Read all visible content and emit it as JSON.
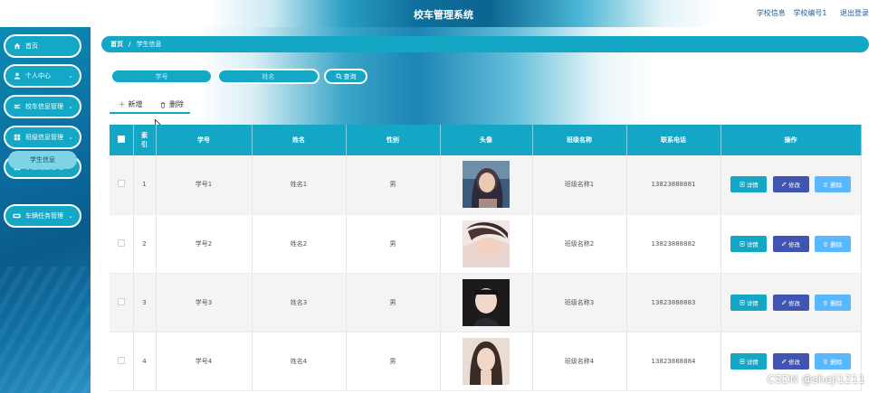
{
  "header": {
    "title": "校车管理系统",
    "school_info": "学校信息",
    "school_id": "学校编号1",
    "logout": "退出登录"
  },
  "sidebar": {
    "items": [
      {
        "label": "首页",
        "icon": "home-icon"
      },
      {
        "label": "个人中心",
        "icon": "user-icon"
      },
      {
        "label": "校车信息管理",
        "icon": "bus-icon"
      },
      {
        "label": "班级信息管理",
        "icon": "grid-icon"
      },
      {
        "label": "学生信息管理",
        "icon": "grid-icon"
      },
      {
        "label": "车辆任务管理",
        "icon": "vehicle-icon"
      }
    ],
    "sub_item": "学生信息"
  },
  "breadcrumb": {
    "home": "首页",
    "separator": "/",
    "current": "学生信息"
  },
  "search": {
    "student_id_placeholder": "学号",
    "name_placeholder": "姓名",
    "query_button": "查询"
  },
  "actions": {
    "add": "新增",
    "delete": "删除"
  },
  "table": {
    "headers": [
      "索引",
      "学号",
      "姓名",
      "性别",
      "头像",
      "班级名称",
      "联系电话",
      "操作"
    ],
    "rows": [
      {
        "index": "1",
        "student_id": "学号1",
        "name": "姓名1",
        "gender": "男",
        "class_name": "班级名称1",
        "phone": "13823888881"
      },
      {
        "index": "2",
        "student_id": "学号2",
        "name": "姓名2",
        "gender": "男",
        "class_name": "班级名称2",
        "phone": "13823888882"
      },
      {
        "index": "3",
        "student_id": "学号3",
        "name": "姓名3",
        "gender": "男",
        "class_name": "班级名称3",
        "phone": "13823888883"
      },
      {
        "index": "4",
        "student_id": "学号4",
        "name": "姓名4",
        "gender": "男",
        "class_name": "班级名称4",
        "phone": "13823888884"
      }
    ],
    "row_buttons": {
      "detail": "详情",
      "edit": "修改",
      "delete": "删除"
    }
  },
  "watermark": "CSDN @sheji1211",
  "colors": {
    "primary": "#13a7c5",
    "edit_button": "#4054b2",
    "delete_button": "#59b8ff",
    "sidebar": "#0b6e9f"
  }
}
